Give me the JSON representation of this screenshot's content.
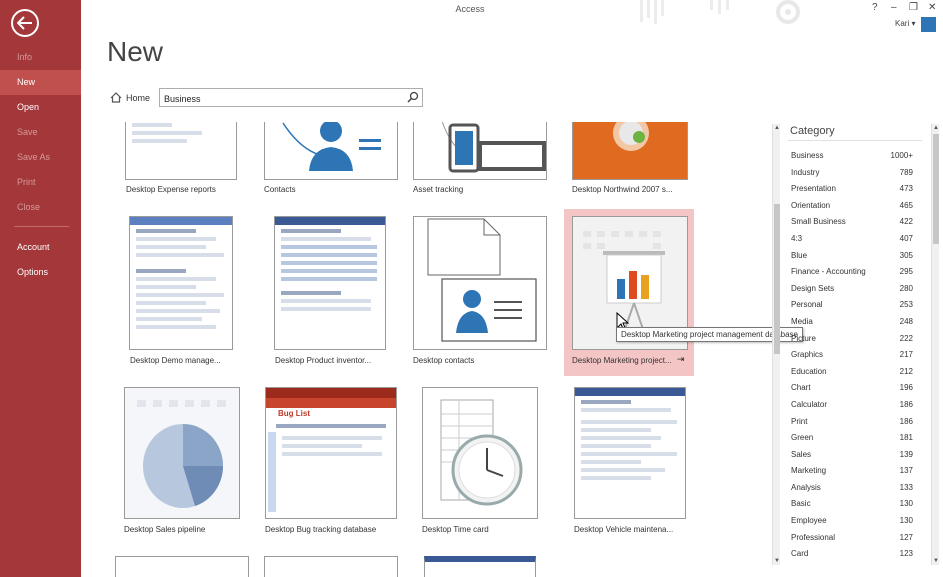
{
  "window": {
    "title": "Access",
    "controls": [
      "?",
      "–",
      "❐",
      "✕"
    ],
    "user": "Kari"
  },
  "sidebar": {
    "items": [
      {
        "label": "Info",
        "state": "disabled"
      },
      {
        "label": "New",
        "state": "selected"
      },
      {
        "label": "Open",
        "state": "normal"
      },
      {
        "label": "Save",
        "state": "disabled"
      },
      {
        "label": "Save As",
        "state": "disabled"
      },
      {
        "label": "Print",
        "state": "disabled"
      },
      {
        "label": "Close",
        "state": "disabled"
      },
      {
        "label": "Account",
        "state": "normal"
      },
      {
        "label": "Options",
        "state": "normal"
      }
    ]
  },
  "page": {
    "title": "New"
  },
  "search": {
    "home_label": "Home",
    "value": "Business"
  },
  "templates": [
    {
      "label": "Desktop Expense reports",
      "thumb": "form-blank"
    },
    {
      "label": "Contacts",
      "thumb": "contact-card"
    },
    {
      "label": "Asset tracking",
      "thumb": "computer"
    },
    {
      "label": "Desktop Northwind 2007 s...",
      "thumb": "northwind"
    },
    {
      "label": "Desktop Demo manage...",
      "thumb": "form-blue"
    },
    {
      "label": "Desktop Product inventor...",
      "thumb": "table-blue"
    },
    {
      "label": "Desktop contacts",
      "thumb": "contact-card"
    },
    {
      "label": "Desktop Marketing project...",
      "thumb": "presentation"
    },
    {
      "label": "Desktop Sales pipeline",
      "thumb": "pie"
    },
    {
      "label": "Desktop Bug tracking database",
      "thumb": "bug-list"
    },
    {
      "label": "Desktop Time card",
      "thumb": "clock"
    },
    {
      "label": "Desktop Vehicle maintena...",
      "thumb": "form-blue"
    }
  ],
  "bug_list_heading": "Bug List",
  "tooltip": "Desktop Marketing project management database",
  "category": {
    "title": "Category",
    "items": [
      {
        "name": "Business",
        "count": "1000+"
      },
      {
        "name": "Industry",
        "count": "789"
      },
      {
        "name": "Presentation",
        "count": "473"
      },
      {
        "name": "Orientation",
        "count": "465"
      },
      {
        "name": "Small Business",
        "count": "422"
      },
      {
        "name": "4:3",
        "count": "407"
      },
      {
        "name": "Blue",
        "count": "305"
      },
      {
        "name": "Finance - Accounting",
        "count": "295"
      },
      {
        "name": "Design Sets",
        "count": "280"
      },
      {
        "name": "Personal",
        "count": "253"
      },
      {
        "name": "Media",
        "count": "248"
      },
      {
        "name": "Picture",
        "count": "222"
      },
      {
        "name": "Graphics",
        "count": "217"
      },
      {
        "name": "Education",
        "count": "212"
      },
      {
        "name": "Chart",
        "count": "196"
      },
      {
        "name": "Calculator",
        "count": "186"
      },
      {
        "name": "Print",
        "count": "186"
      },
      {
        "name": "Green",
        "count": "181"
      },
      {
        "name": "Sales",
        "count": "139"
      },
      {
        "name": "Marketing",
        "count": "137"
      },
      {
        "name": "Analysis",
        "count": "133"
      },
      {
        "name": "Basic",
        "count": "130"
      },
      {
        "name": "Employee",
        "count": "130"
      },
      {
        "name": "Professional",
        "count": "127"
      },
      {
        "name": "Card",
        "count": "123"
      }
    ]
  },
  "colors": {
    "accent": "#a4373a",
    "selected_nav": "#c0504d",
    "selected_tile": "#f4c5c5",
    "office_blue": "#2e75b6"
  }
}
